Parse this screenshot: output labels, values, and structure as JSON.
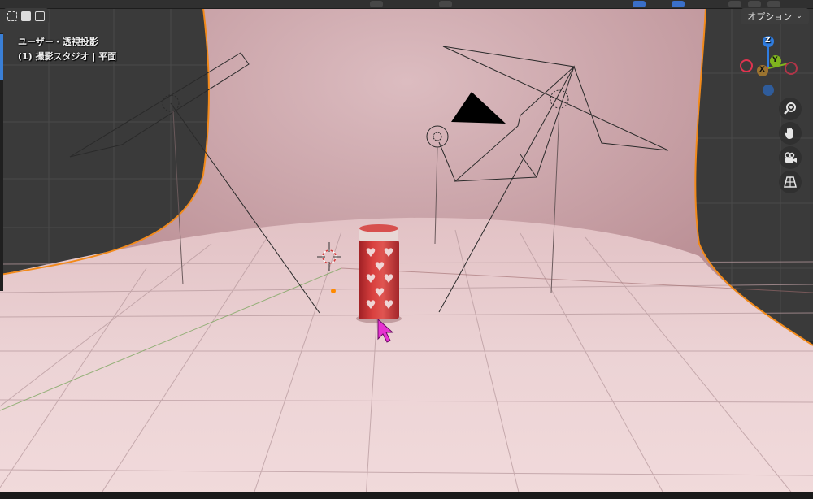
{
  "viewport": {
    "view_label": "ユーザー・透視投影",
    "collection_label": "(1) 撮影スタジオ | 平面"
  },
  "header": {
    "options_label": "オプション",
    "options_icon": "chevron-down-icon"
  },
  "gizmo": {
    "axes": [
      {
        "name": "Z",
        "color": "#2f7de1"
      },
      {
        "name": "Y",
        "color": "#7fb51e"
      },
      {
        "name": "X",
        "color": "#e0334f"
      }
    ]
  },
  "nav_tools": [
    {
      "name": "zoom",
      "icon": "zoom-icon"
    },
    {
      "name": "pan",
      "icon": "hand-icon"
    },
    {
      "name": "camera",
      "icon": "camera-icon"
    },
    {
      "name": "perspective",
      "icon": "grid-perspective-icon"
    }
  ],
  "colors": {
    "selection_outline": "#f28a1a",
    "cursor": "#e632d0",
    "backdrop_top": "#d9b3b7",
    "floor": "#ecd1d3"
  }
}
